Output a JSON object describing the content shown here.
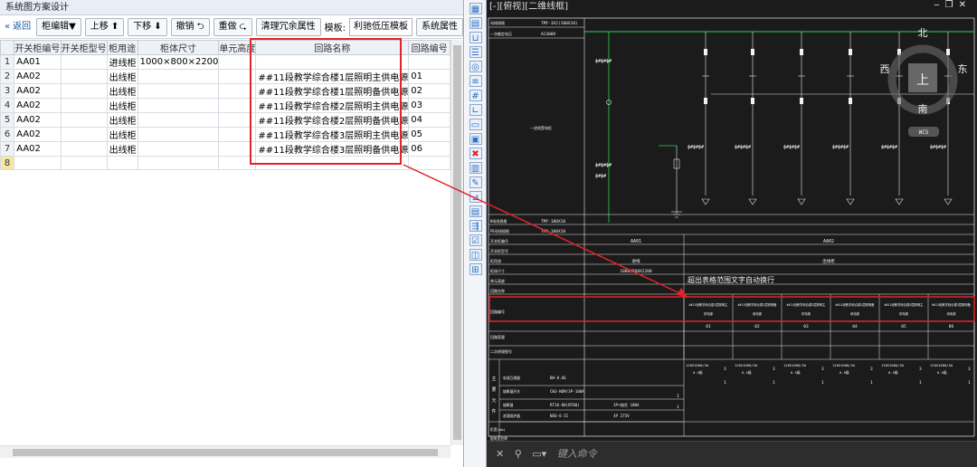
{
  "left_panel": {
    "title": "系统图方案设计",
    "toolbar": {
      "back": "返回",
      "cabinet_edit": "柜编辑▼",
      "move_up": "上移",
      "move_down": "下移",
      "undo": "撤销",
      "redo": "重做",
      "clean_attrs": "清理冗余属性",
      "template_label": "模板:",
      "template_value": "利驰低压模板",
      "system_props": "系统属性"
    },
    "columns": [
      "开关柜编号",
      "开关柜型号",
      "柜用途",
      "柜体尺寸",
      "单元高度",
      "回路名称",
      "回路编号"
    ],
    "rows": [
      {
        "n": "1",
        "cab": "AA01",
        "model": "",
        "use": "进线柜",
        "size": "1000×800×2200",
        "unit": "",
        "circuit": "",
        "cno": ""
      },
      {
        "n": "2",
        "cab": "AA02",
        "model": "",
        "use": "出线柜",
        "size": "",
        "unit": "",
        "circuit": "##11段教学综合楼1层照明主供电源",
        "cno": "01"
      },
      {
        "n": "3",
        "cab": "AA02",
        "model": "",
        "use": "出线柜",
        "size": "",
        "unit": "",
        "circuit": "##11段教学综合楼1层照明备供电源",
        "cno": "02"
      },
      {
        "n": "4",
        "cab": "AA02",
        "model": "",
        "use": "出线柜",
        "size": "",
        "unit": "",
        "circuit": "##11段教学综合楼2层照明主供电源",
        "cno": "03"
      },
      {
        "n": "5",
        "cab": "AA02",
        "model": "",
        "use": "出线柜",
        "size": "",
        "unit": "",
        "circuit": "##11段教学综合楼2层照明备供电源",
        "cno": "04"
      },
      {
        "n": "6",
        "cab": "AA02",
        "model": "",
        "use": "出线柜",
        "size": "",
        "unit": "",
        "circuit": "##11段教学综合楼3层照明主供电源",
        "cno": "05"
      },
      {
        "n": "7",
        "cab": "AA02",
        "model": "",
        "use": "出线柜",
        "size": "",
        "unit": "",
        "circuit": "##11段教学综合楼3层照明备供电源",
        "cno": "06"
      },
      {
        "n": "8",
        "cab": "",
        "model": "",
        "use": "",
        "size": "",
        "unit": "",
        "circuit": "",
        "cno": ""
      }
    ]
  },
  "cad": {
    "title": "[-][俯视][二维线框]",
    "compass": {
      "n": "北",
      "s": "南",
      "e": "东",
      "w": "西",
      "top": "上",
      "wcs": "WCS"
    },
    "bus_label_1": "TMY-3X2(100X10)",
    "bus_label_2": "AC400V",
    "left_row_labels": [
      "N母线规格",
      "PE母线规格",
      "开关柜编号",
      "开关柜型号",
      "柜用途",
      "柜体尺寸",
      "单元高度",
      "回路名称",
      "回路编号",
      "回路容量",
      "二次原理图号"
    ],
    "n_bus": "TMY-100X10",
    "pe_bus": "TMY-100X10",
    "cab_aa01": "AA01",
    "cab_aa02": "AA02",
    "use_in": "进线",
    "use_out": "出线柜",
    "size_aa01": "1000X800X2200",
    "annotation": "超出表格范围文字自动换行",
    "circuit_names": [
      "##11段教学综合楼1层照明主",
      "##11段教学综合楼1层照明备",
      "##11段教学综合楼2层照明主",
      "##11段教学综合楼2层照明备",
      "##11段教学综合楼3层照明主",
      "##11段教学综合楼3层照明备"
    ],
    "circuit_tail": [
      "供电源",
      "用电源",
      "供电源",
      "用电源",
      "供电源",
      "用电源"
    ],
    "circuit_nums": [
      "01",
      "02",
      "03",
      "04",
      "05",
      "06"
    ],
    "equip_rows": [
      {
        "label": "电流互感器",
        "spec": "BH-0.66",
        "spec2": ""
      },
      {
        "label": "熔断器开关",
        "spec": "CW3-N6M/3P-100A",
        "spec2": ""
      },
      {
        "label": "熔断器",
        "spec": "RT36-00(NT00)",
        "spec2": "3P+熔芯 100A"
      },
      {
        "label": "浪涌保护器",
        "spec": "NXU-6-II",
        "spec2": "4P 275V"
      }
    ],
    "equip_side": [
      "主",
      "要",
      "元",
      "件"
    ],
    "bottom_labels": [
      "柜宽(mm)",
      "配电室名称"
    ],
    "ct_spec": "120X1000/5A",
    "ct_spec2": "0.5级",
    "ct_qty": "3",
    "one": "1",
    "cmd_prompt": "键入命令"
  }
}
